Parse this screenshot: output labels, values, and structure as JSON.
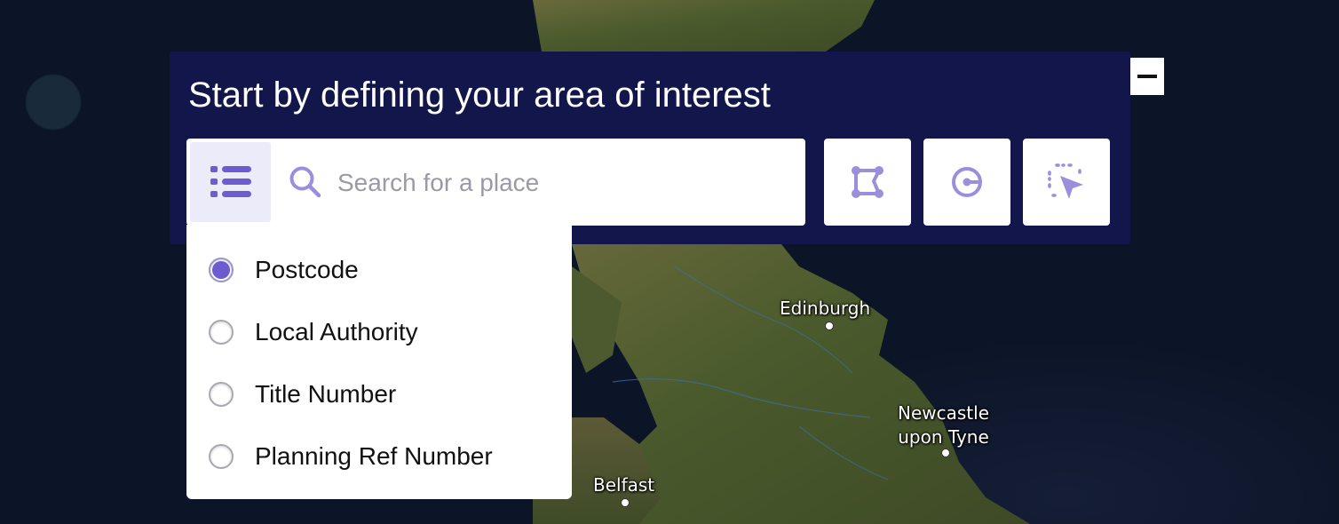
{
  "map": {
    "cities": [
      {
        "name": "Edinburgh"
      },
      {
        "name": "Newcastle\nupon Tyne"
      },
      {
        "name": "Belfast"
      }
    ]
  },
  "panel": {
    "title": "Start by defining your area of interest",
    "search": {
      "placeholder": "Search for a place",
      "value": ""
    },
    "tools": [
      {
        "icon": "polygon-draw-icon"
      },
      {
        "icon": "radius-circle-icon"
      },
      {
        "icon": "select-area-cursor-icon"
      }
    ],
    "collapse_icon": "minus-icon"
  },
  "search_type_options": [
    {
      "label": "Postcode",
      "selected": true
    },
    {
      "label": "Local Authority",
      "selected": false
    },
    {
      "label": "Title Number",
      "selected": false
    },
    {
      "label": "Planning Ref Number",
      "selected": false
    }
  ],
  "colors": {
    "panel_bg": "#12164a",
    "accent": "#6d5bd0",
    "icon_accent": "#9b8fdc",
    "toggle_bg": "#ecebfa"
  }
}
